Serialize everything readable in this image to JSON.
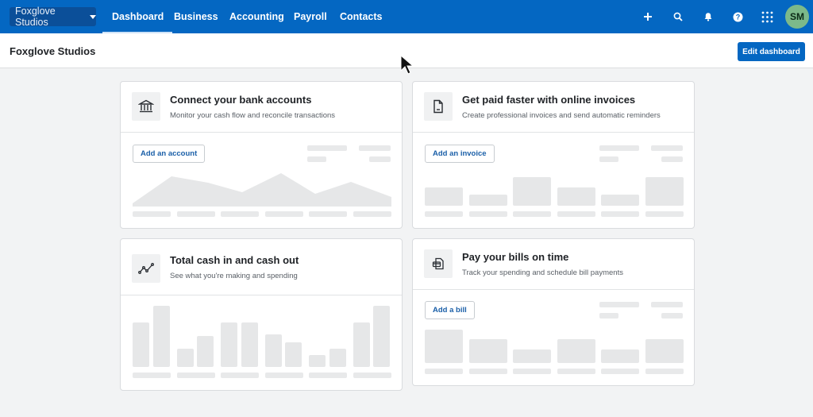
{
  "topnav": {
    "org_switcher": "Foxglove Studios",
    "tabs": [
      {
        "label": "Dashboard",
        "active": true
      },
      {
        "label": "Business",
        "active": false
      },
      {
        "label": "Accounting",
        "active": false
      },
      {
        "label": "Payroll",
        "active": false
      },
      {
        "label": "Contacts",
        "active": false
      }
    ],
    "icons": [
      "plus-icon",
      "search-icon",
      "bell-icon",
      "help-icon",
      "apps-grid-icon"
    ],
    "avatar_initials": "SM",
    "colors": {
      "nav_bg": "#0467c2",
      "avatar_bg": "#7cb98a"
    }
  },
  "subbar": {
    "title": "Foxglove Studios",
    "edit_button": "Edit dashboard"
  },
  "cards": [
    {
      "id": "bank",
      "icon": "bank-icon",
      "title": "Connect your bank accounts",
      "subtitle": "Monitor your cash flow and reconcile transactions",
      "button": "Add an account",
      "placeholder_chart": "area"
    },
    {
      "id": "invoices",
      "icon": "invoice-document-icon",
      "title": "Get paid faster with online invoices",
      "subtitle": "Create professional invoices and send automatic reminders",
      "button": "Add an invoice",
      "placeholder_chart": "bar",
      "placeholder_values": [
        0.55,
        0.33,
        0.85,
        0.55,
        0.33,
        0.85
      ]
    },
    {
      "id": "cash",
      "icon": "line-chart-icon",
      "title": "Total cash in and cash out",
      "subtitle": "See what you're making and spending",
      "placeholder_chart": "grouped-bar",
      "placeholder_values": [
        [
          0.73,
          1.0
        ],
        [
          0.3,
          0.51
        ],
        [
          0.73,
          0.73
        ],
        [
          0.53,
          0.4
        ],
        [
          0.2,
          0.3
        ],
        [
          0.73,
          1.0
        ]
      ]
    },
    {
      "id": "bills",
      "icon": "bill-icon",
      "title": "Pay your bills on time",
      "subtitle": "Track your spending and schedule bill payments",
      "button": "Add a bill",
      "placeholder_chart": "bar",
      "placeholder_values": [
        1.0,
        0.72,
        0.4,
        0.72,
        0.4,
        0.72
      ]
    }
  ]
}
